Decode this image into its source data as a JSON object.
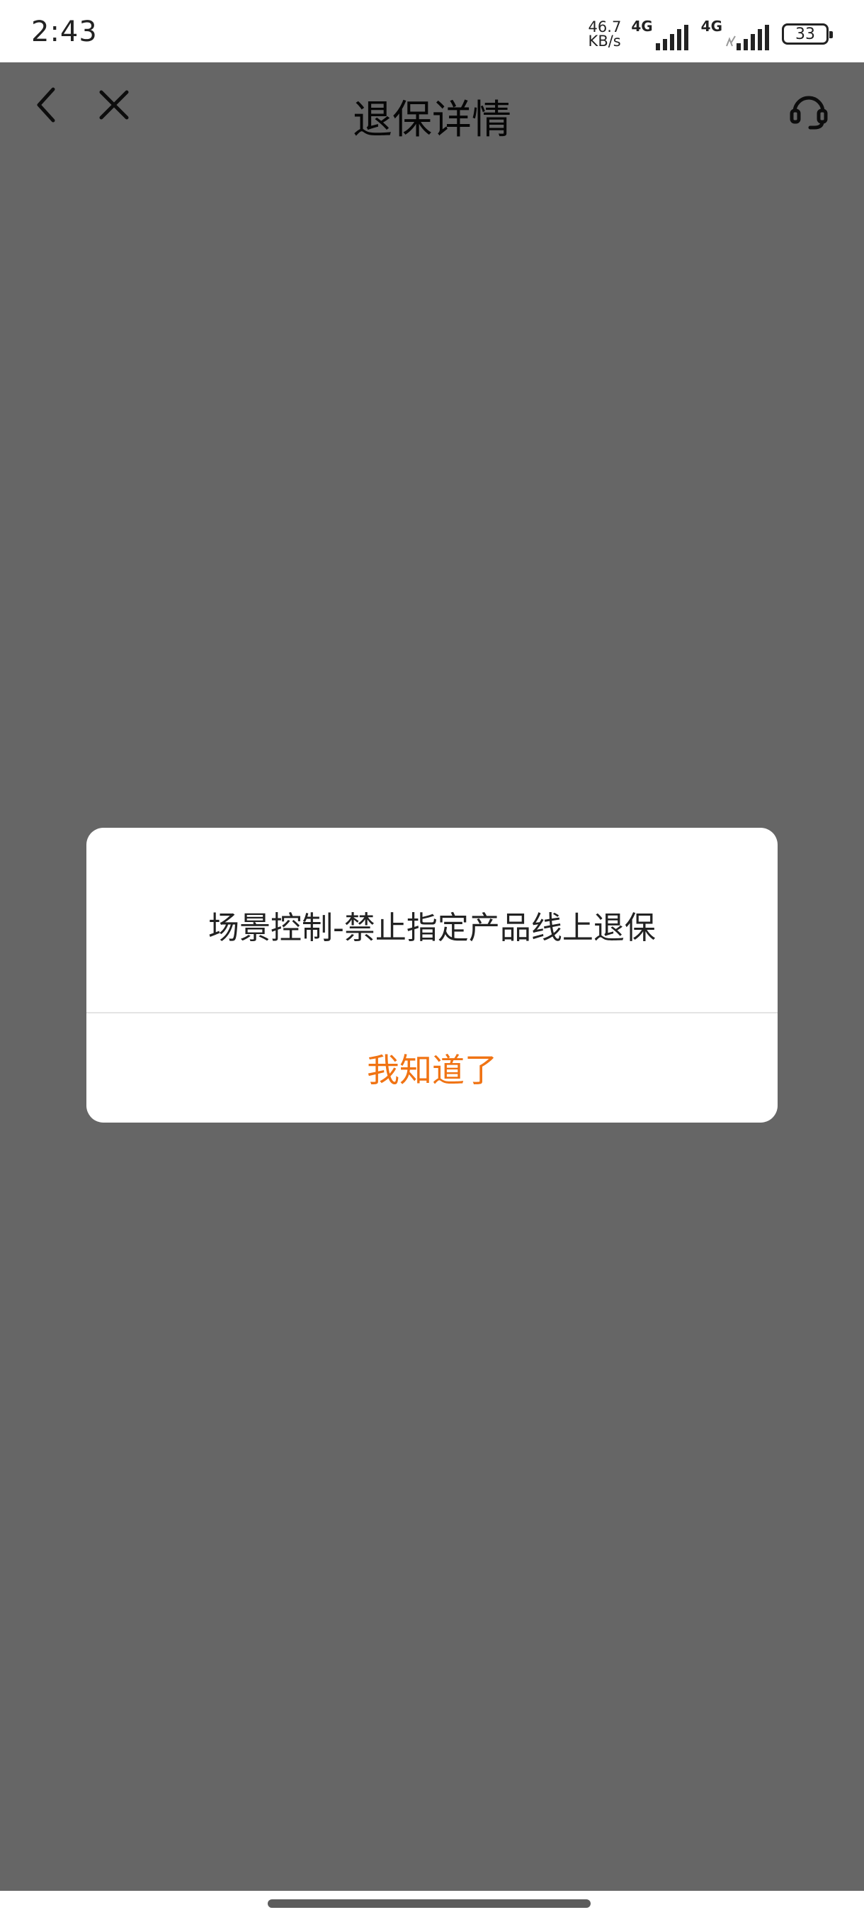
{
  "status_bar": {
    "time": "2:43",
    "net_speed_value": "46.7",
    "net_speed_unit": "KB/s",
    "sim1_label": "4G",
    "sim2_label": "4G",
    "battery": "33"
  },
  "nav": {
    "title": "退保详情",
    "back_icon": "chevron-left-icon",
    "close_icon": "close-icon",
    "service_icon": "headset-icon"
  },
  "dialog": {
    "message": "场景控制-禁止指定产品线上退保",
    "confirm_label": "我知道了"
  },
  "colors": {
    "accent": "#f07313",
    "overlay": "rgba(0,0,0,0.6)"
  }
}
